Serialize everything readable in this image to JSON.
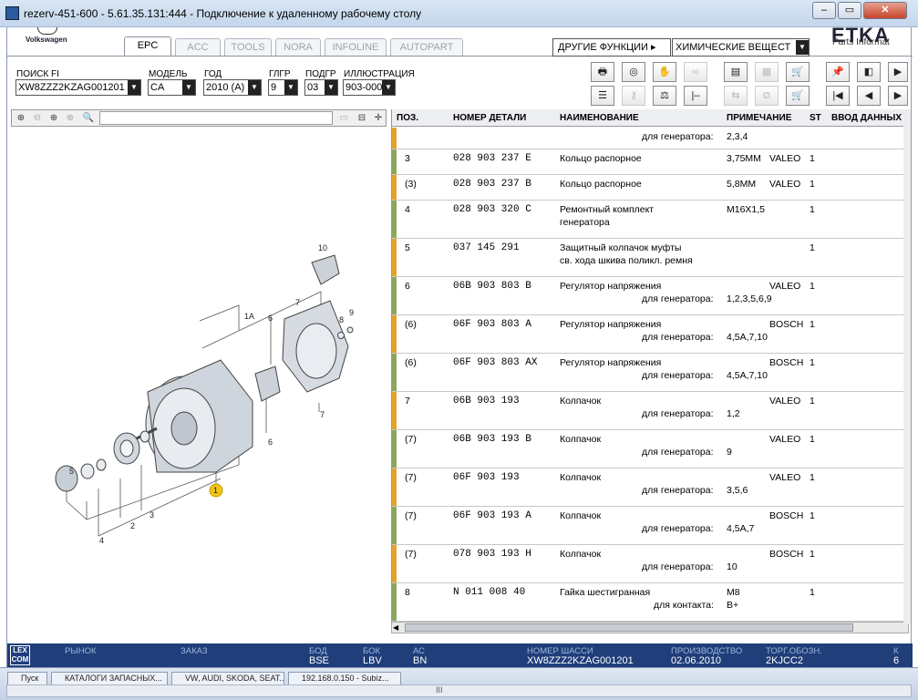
{
  "window": {
    "title": "rezerv-451-600 - 5.61.35.131:444 - Подключение к удаленному рабочему столу"
  },
  "brand": {
    "name": "Volkswagen",
    "etka": "ETKA",
    "etka_sub": "Parts Informat"
  },
  "tabs": [
    "EPC",
    "ACC",
    "TOOLS",
    "NORA",
    "INFOLINE",
    "AUTOPART"
  ],
  "functions": {
    "label": "ДРУГИЕ ФУНКЦИИ ▸",
    "selected": "ХИМИЧЕСКИЕ ВЕЩЕСТ"
  },
  "filters": {
    "vin_label": "ПОИСК FI",
    "vin_value": "XW8ZZZ2KZAG001201",
    "model_label": "МОДЕЛЬ",
    "model_value": "CA",
    "year_label": "ГОД",
    "year_value": "2010 (A)",
    "group_label": "ГЛГР",
    "group_value": "9",
    "subgroup_label": "ПОДГР",
    "subgroup_value": "03",
    "illustration_label": "ИЛЛЮСТРАЦИЯ",
    "illustration_value": "903-000"
  },
  "grid": {
    "headers": {
      "pos": "ПОЗ.",
      "part": "НОМЕР ДЕТАЛИ",
      "name": "НАИМЕНОВАНИЕ",
      "note": "ПРИМЕЧАНИЕ",
      "st": "ST",
      "input": "ВВОД ДАННЫХ"
    },
    "rows": [
      {
        "pos": "",
        "part": "",
        "name": "",
        "sub_label": "для генератора:",
        "sub_value": "2,3,4",
        "note": "",
        "brand": "",
        "qty": ""
      },
      {
        "pos": "3",
        "part": "028 903 237 E",
        "name": "Кольцо распорное",
        "sub_label": "",
        "sub_value": "",
        "note": "3,75ММ",
        "brand": "VALEO",
        "qty": "1"
      },
      {
        "pos": "(3)",
        "part": "028 903 237 B",
        "name": "Кольцо распорное",
        "sub_label": "",
        "sub_value": "",
        "note": "5,8ММ",
        "brand": "VALEO",
        "qty": "1"
      },
      {
        "pos": "4",
        "part": "028 903 320 C",
        "name": "Ремонтный комплект",
        "name2": "генератора",
        "sub_label": "",
        "sub_value": "",
        "note": "M16X1,5",
        "brand": "",
        "qty": "1"
      },
      {
        "pos": "5",
        "part": "037 145 291",
        "name": "Защитный колпачок муфты",
        "name2": "св. хода шкива поликл. ремня",
        "sub_label": "",
        "sub_value": "",
        "note": "",
        "brand": "",
        "qty": "1"
      },
      {
        "pos": "6",
        "part": "06B 903 803 B",
        "name": "Регулятор напряжения",
        "sub_label": "для генератора:",
        "sub_value": "1,2,3,5,6,9",
        "note": "",
        "brand": "VALEO",
        "qty": "1"
      },
      {
        "pos": "(6)",
        "part": "06F 903 803 A",
        "name": "Регулятор напряжения",
        "sub_label": "для генератора:",
        "sub_value": "4,5A,7,10",
        "note": "",
        "brand": "BOSCH",
        "qty": "1"
      },
      {
        "pos": "(6)",
        "part": "06F 903 803 AX",
        "name": "Регулятор напряжения",
        "sub_label": "для генератора:",
        "sub_value": "4,5A,7,10",
        "note": "",
        "brand": "BOSCH",
        "qty": "1"
      },
      {
        "pos": "7",
        "part": "06B 903 193",
        "name": "Колпачок",
        "sub_label": "для генератора:",
        "sub_value": "1,2",
        "note": "",
        "brand": "VALEO",
        "qty": "1"
      },
      {
        "pos": "(7)",
        "part": "06B 903 193 B",
        "name": "Колпачок",
        "sub_label": "для генератора:",
        "sub_value": "9",
        "note": "",
        "brand": "VALEO",
        "qty": "1"
      },
      {
        "pos": "(7)",
        "part": "06F 903 193",
        "name": "Колпачок",
        "sub_label": "для генератора:",
        "sub_value": "3,5,6",
        "note": "",
        "brand": "VALEO",
        "qty": "1"
      },
      {
        "pos": "(7)",
        "part": "06F 903 193 A",
        "name": "Колпачок",
        "sub_label": "для генератора:",
        "sub_value": "4,5A,7",
        "note": "",
        "brand": "BOSCH",
        "qty": "1"
      },
      {
        "pos": "(7)",
        "part": "078 903 193 H",
        "name": "Колпачок",
        "sub_label": "для генератора:",
        "sub_value": "10",
        "note": "",
        "brand": "BOSCH",
        "qty": "1"
      },
      {
        "pos": "8",
        "part": "N   011 008 40",
        "name": "Гайка шестигранная",
        "sub_label": "для контакта:",
        "sub_value": "B+",
        "note": "M8",
        "brand": "",
        "qty": "1"
      }
    ]
  },
  "illustration": {
    "callouts": [
      "1",
      "1A",
      "2",
      "3",
      "4",
      "5",
      "6",
      "6",
      "7",
      "7",
      "8",
      "9",
      "10"
    ]
  },
  "status": {
    "market_label": "РЫНОК",
    "order_label": "ЗАКАЗ",
    "bod_label": "БОД",
    "bod_value": "BSE",
    "bok_label": "БОК",
    "bok_value": "LBV",
    "ac_label": "АС",
    "ac_value": "BN",
    "chassis_label": "НОМЕР ШАССИ",
    "chassis_value": "XW8ZZZ2KZAG001201",
    "prod_label": "ПРОИЗВОДСТВО",
    "prod_value": "02.06.2010",
    "trade_label": "ТОРГ.ОБОЗН.",
    "trade_value": "2KJCC2",
    "extra_label": "К",
    "extra_value": "6"
  },
  "taskbar": {
    "items": [
      "Пуск",
      "КАТАЛОГИ ЗАПАСНЫХ...",
      "VW, AUDI, SKODA, SEAT...",
      "192.168.0.150 - Subiz..."
    ],
    "scroll_mark": "III"
  },
  "colors": {
    "status_bg": "#1f3e7a",
    "row_marker_orange": "#e5a22a",
    "row_marker_green": "#8aa85a",
    "callout_yellow": "#f0c419"
  }
}
